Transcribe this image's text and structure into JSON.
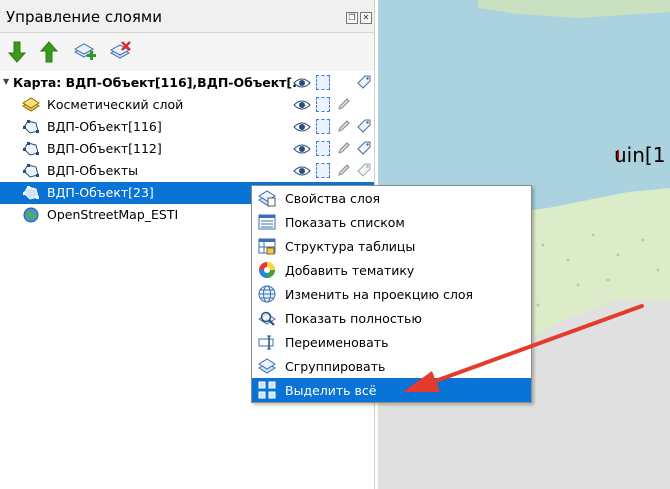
{
  "panel": {
    "title": "Управление слоями",
    "header_buttons": [
      "restore-icon",
      "close-icon"
    ]
  },
  "toolbar": {
    "buttons": [
      {
        "name": "move-layer-down-button",
        "icon": "arrow-down-icon",
        "color": "#3a9a1c"
      },
      {
        "name": "move-layer-up-button",
        "icon": "arrow-up-icon",
        "color": "#3a9a1c"
      },
      {
        "name": "add-layer-button",
        "icon": "add-layer-icon"
      },
      {
        "name": "remove-layer-button",
        "icon": "remove-layer-icon"
      }
    ]
  },
  "tree": {
    "group": {
      "label": "Карта: ВДП-Объект[116],ВДП-Объект[..."
    },
    "layers": [
      {
        "label": "Косметический слой",
        "icon": "cosmetic-layer-icon",
        "editable": true,
        "labels": false
      },
      {
        "label": "ВДП-Объект[116]",
        "icon": "vector-layer-icon",
        "editable": true,
        "labels": true
      },
      {
        "label": "ВДП-Объект[112]",
        "icon": "vector-layer-icon",
        "editable": true,
        "labels": true
      },
      {
        "label": "ВДП-Объекты",
        "icon": "vector-layer-icon",
        "editable": true,
        "labels": true
      },
      {
        "label": "ВДП-Объект[23]",
        "icon": "vector-layer-icon",
        "editable": true,
        "labels": true,
        "selected": true
      },
      {
        "label": "OpenStreetMap_ESTI",
        "icon": "globe-icon",
        "editable": false,
        "labels": false
      }
    ]
  },
  "context_menu": {
    "items": [
      {
        "label": "Свойства слоя",
        "icon": "layer-properties-icon"
      },
      {
        "label": "Показать списком",
        "icon": "list-view-icon"
      },
      {
        "label": "Структура таблицы",
        "icon": "table-structure-icon"
      },
      {
        "label": "Добавить тематику",
        "icon": "thematic-icon"
      },
      {
        "label": "Изменить на проекцию слоя",
        "icon": "projection-icon"
      },
      {
        "label": "Показать полностью",
        "icon": "zoom-extent-icon"
      },
      {
        "label": "Переименовать",
        "icon": "rename-icon"
      },
      {
        "label": "Сгруппировать",
        "icon": "group-icon"
      },
      {
        "label": "Выделить всё",
        "icon": "select-all-icon",
        "highlighted": true
      }
    ]
  },
  "map": {
    "label_text": "uin[1",
    "colors": {
      "water": "#aad3df",
      "land": "#e2efd3",
      "background": "#e0e0e0",
      "marker": "#e00000"
    }
  },
  "colors": {
    "selection": "#0a74d6",
    "annotation_arrow": "#e53a2e"
  }
}
